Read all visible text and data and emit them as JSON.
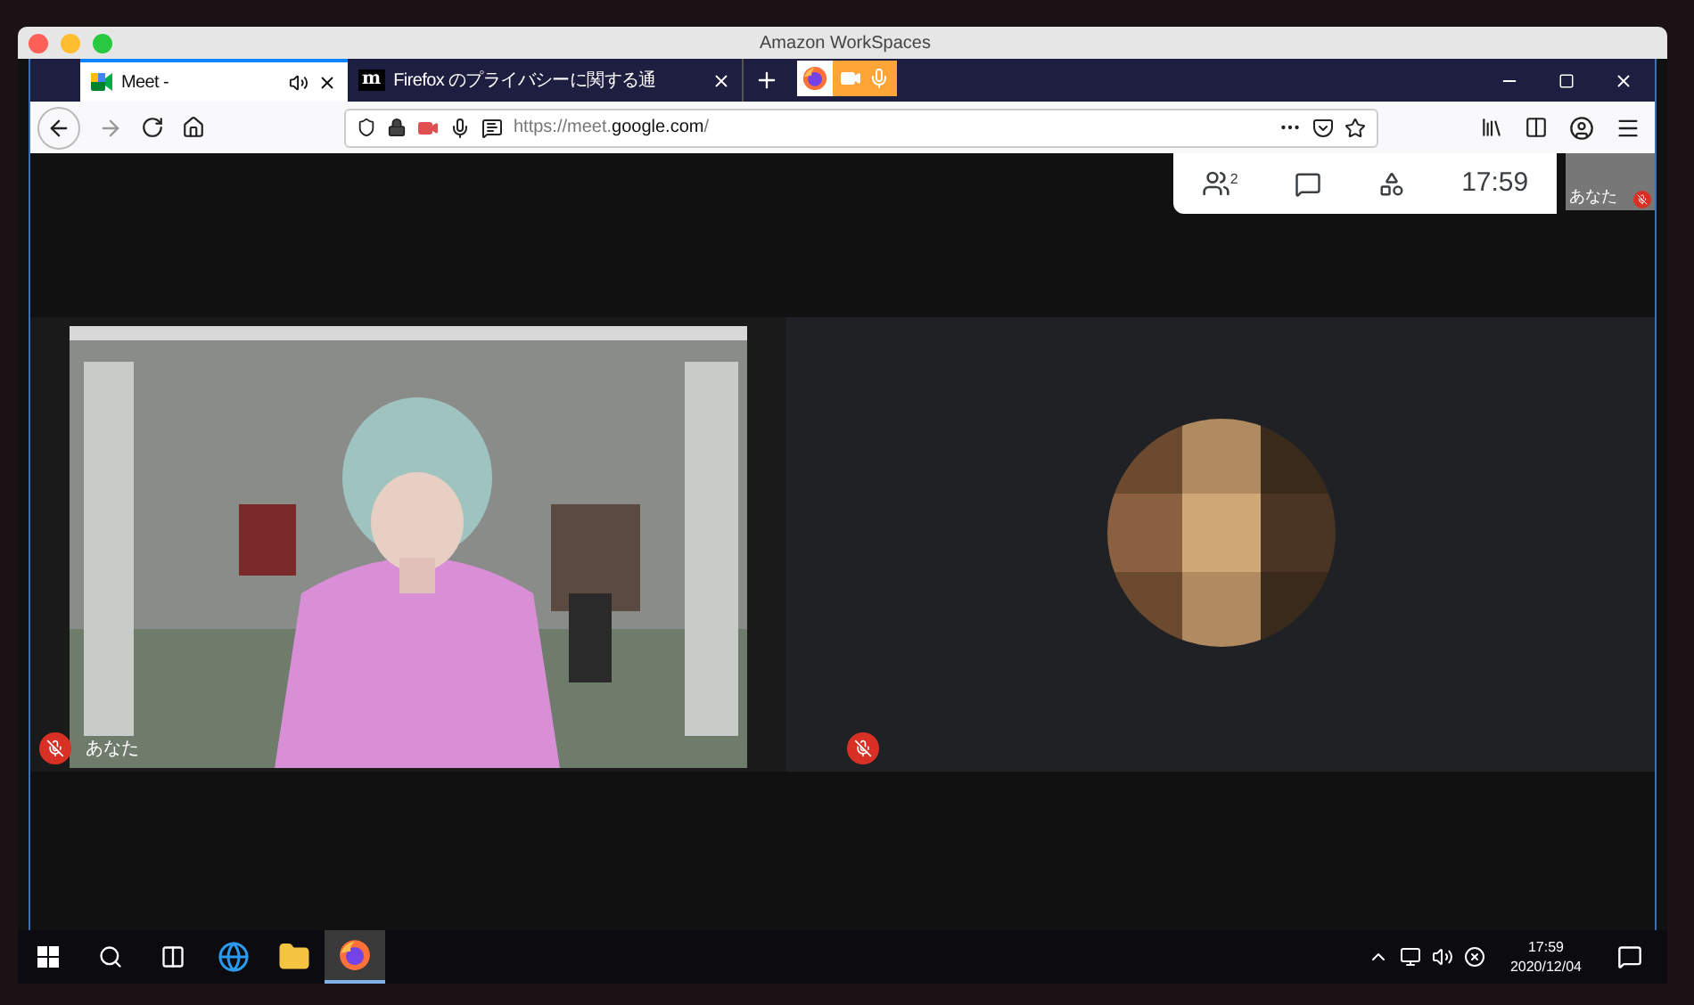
{
  "app_window": {
    "title": "Amazon WorkSpaces"
  },
  "tabs": [
    {
      "title": "Meet - ",
      "selected": true,
      "kind": "meet",
      "audio": true
    },
    {
      "title": "Firefox のプライバシーに関する通",
      "selected": false,
      "kind": "mozilla",
      "icon_text": "m",
      "audio": false
    }
  ],
  "sharing_indicator": {
    "camera": true,
    "microphone": true
  },
  "address_bar": {
    "url_start": "https://meet.",
    "url_domain": "google.com",
    "url_end": "/"
  },
  "meeting": {
    "participants_count": "2",
    "clock": "17:59",
    "self_view": {
      "label": "あなた",
      "muted": true
    },
    "tiles": [
      {
        "kind": "video",
        "name": "あなた",
        "muted": true
      },
      {
        "kind": "avatar",
        "muted": true
      }
    ]
  },
  "taskbar": {
    "apps": [
      {
        "kind": "ie",
        "selected": false
      },
      {
        "kind": "explorer",
        "selected": false
      },
      {
        "kind": "firefox",
        "selected": true
      }
    ],
    "time": "17:59",
    "date": "2020/12/04"
  }
}
